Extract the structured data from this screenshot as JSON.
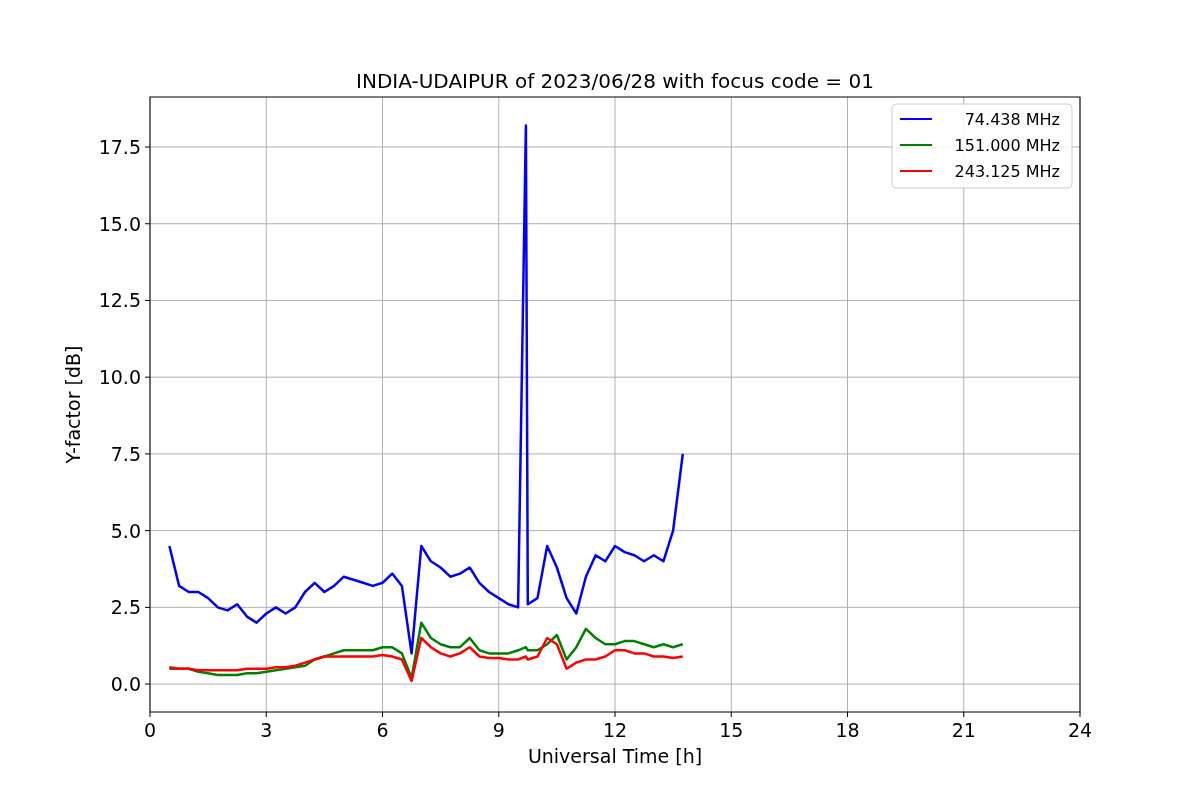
{
  "figure": {
    "chart_data": {
      "type": "line",
      "title": "INDIA-UDAIPUR of 2023/06/28 with focus code = 01",
      "xlabel": "Universal Time [h]",
      "ylabel": "Y-factor [dB]",
      "x": [
        0.5,
        0.75,
        1,
        1.25,
        1.5,
        1.75,
        2,
        2.25,
        2.5,
        2.75,
        3,
        3.25,
        3.5,
        3.75,
        4,
        4.25,
        4.5,
        4.75,
        5,
        5.25,
        5.5,
        5.75,
        6,
        6.25,
        6.5,
        6.75,
        7,
        7.25,
        7.5,
        7.75,
        8,
        8.25,
        8.5,
        8.75,
        9,
        9.25,
        9.5,
        9.7,
        9.75,
        10,
        10.25,
        10.5,
        10.75,
        11,
        11.25,
        11.5,
        11.75,
        12,
        12.25,
        12.5,
        12.75,
        13,
        13.25,
        13.5,
        13.75
      ],
      "series": [
        {
          "name": "74.438 MHz",
          "color": "#0000ff",
          "values": [
            4.5,
            3.2,
            3.0,
            3.0,
            2.8,
            2.5,
            2.4,
            2.6,
            2.2,
            2.0,
            2.3,
            2.5,
            2.3,
            2.5,
            3.0,
            3.3,
            3.0,
            3.2,
            3.5,
            3.4,
            3.3,
            3.2,
            3.3,
            3.6,
            3.2,
            1.0,
            4.5,
            4.0,
            3.8,
            3.5,
            3.6,
            3.8,
            3.3,
            3.0,
            2.8,
            2.6,
            2.5,
            18.2,
            2.6,
            2.8,
            4.5,
            3.8,
            2.8,
            2.3,
            3.5,
            4.2,
            4.0,
            4.5,
            4.3,
            4.2,
            4.0,
            4.2,
            4.0,
            5.0,
            7.5
          ]
        },
        {
          "name": "151.000 MHz",
          "color": "#008000",
          "values": [
            0.5,
            0.5,
            0.5,
            0.4,
            0.35,
            0.3,
            0.3,
            0.3,
            0.35,
            0.35,
            0.4,
            0.45,
            0.5,
            0.55,
            0.6,
            0.8,
            0.9,
            1.0,
            1.1,
            1.1,
            1.1,
            1.1,
            1.2,
            1.2,
            1.0,
            0.2,
            2.0,
            1.5,
            1.3,
            1.2,
            1.2,
            1.5,
            1.1,
            1.0,
            1.0,
            1.0,
            1.1,
            1.2,
            1.1,
            1.1,
            1.3,
            1.6,
            0.8,
            1.2,
            1.8,
            1.5,
            1.3,
            1.3,
            1.4,
            1.4,
            1.3,
            1.2,
            1.3,
            1.2,
            1.3
          ]
        },
        {
          "name": "243.125 MHz",
          "color": "#ff0000",
          "values": [
            0.55,
            0.5,
            0.5,
            0.45,
            0.45,
            0.45,
            0.45,
            0.45,
            0.5,
            0.5,
            0.5,
            0.55,
            0.55,
            0.6,
            0.7,
            0.8,
            0.9,
            0.9,
            0.9,
            0.9,
            0.9,
            0.9,
            0.95,
            0.9,
            0.8,
            0.1,
            1.5,
            1.2,
            1.0,
            0.9,
            1.0,
            1.2,
            0.9,
            0.85,
            0.85,
            0.8,
            0.8,
            0.9,
            0.8,
            0.9,
            1.5,
            1.3,
            0.5,
            0.7,
            0.8,
            0.8,
            0.9,
            1.1,
            1.1,
            1.0,
            1.0,
            0.9,
            0.9,
            0.85,
            0.9
          ]
        }
      ],
      "grid": true,
      "legend": true,
      "xlim": [
        0,
        24
      ],
      "ylim": [
        -0.91,
        19.13
      ],
      "xticks": [
        0,
        3,
        6,
        9,
        12,
        15,
        18,
        21,
        24
      ],
      "yticks": [
        {
          "value": 0,
          "label": "0.0"
        },
        {
          "value": 2.5,
          "label": "2.5"
        },
        {
          "value": 5,
          "label": "5.0"
        },
        {
          "value": 7.5,
          "label": "7.5"
        },
        {
          "value": 10,
          "label": "10.0"
        },
        {
          "value": 12.5,
          "label": "12.5"
        },
        {
          "value": 15,
          "label": "15.0"
        },
        {
          "value": 17.5,
          "label": "17.5"
        }
      ]
    }
  }
}
